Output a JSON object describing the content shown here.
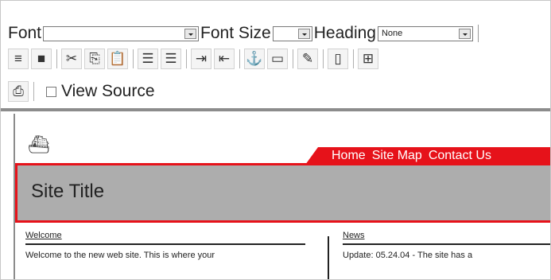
{
  "toolbar": {
    "font_label": "Font",
    "font_value": "",
    "size_label": "Font Size",
    "size_value": "",
    "heading_label": "Heading",
    "heading_value": "None",
    "view_source_label": "View Source",
    "view_source_checked": false,
    "buttons": [
      {
        "name": "align-justify",
        "icon": "≡"
      },
      {
        "name": "align-block",
        "icon": "■"
      },
      {
        "name": "cut",
        "icon": "✂"
      },
      {
        "name": "copy",
        "icon": "⎘"
      },
      {
        "name": "paste",
        "icon": "📋"
      },
      {
        "name": "ordered-list",
        "icon": "☰"
      },
      {
        "name": "unordered-list",
        "icon": "☰"
      },
      {
        "name": "indent",
        "icon": "⇥"
      },
      {
        "name": "outdent",
        "icon": "⇤"
      },
      {
        "name": "anchor",
        "icon": "⚓"
      },
      {
        "name": "insert-image",
        "icon": "▭"
      },
      {
        "name": "edit",
        "icon": "✎"
      },
      {
        "name": "document",
        "icon": "▯"
      },
      {
        "name": "table",
        "icon": "⊞"
      }
    ],
    "page_button_icon": "⎙"
  },
  "preview": {
    "logo": "⛴",
    "nav": [
      "Home",
      "Site Map",
      "Contact Us"
    ],
    "site_title": "Site Title",
    "welcome": {
      "heading": "Welcome",
      "text": "Welcome to the new web site. This is where your"
    },
    "news": {
      "heading": "News",
      "text": "Update: 05.24.04 - The site has a"
    }
  },
  "colors": {
    "accent": "#e6121a",
    "title_bg": "#adadad",
    "separator": "#8c8c8c"
  }
}
